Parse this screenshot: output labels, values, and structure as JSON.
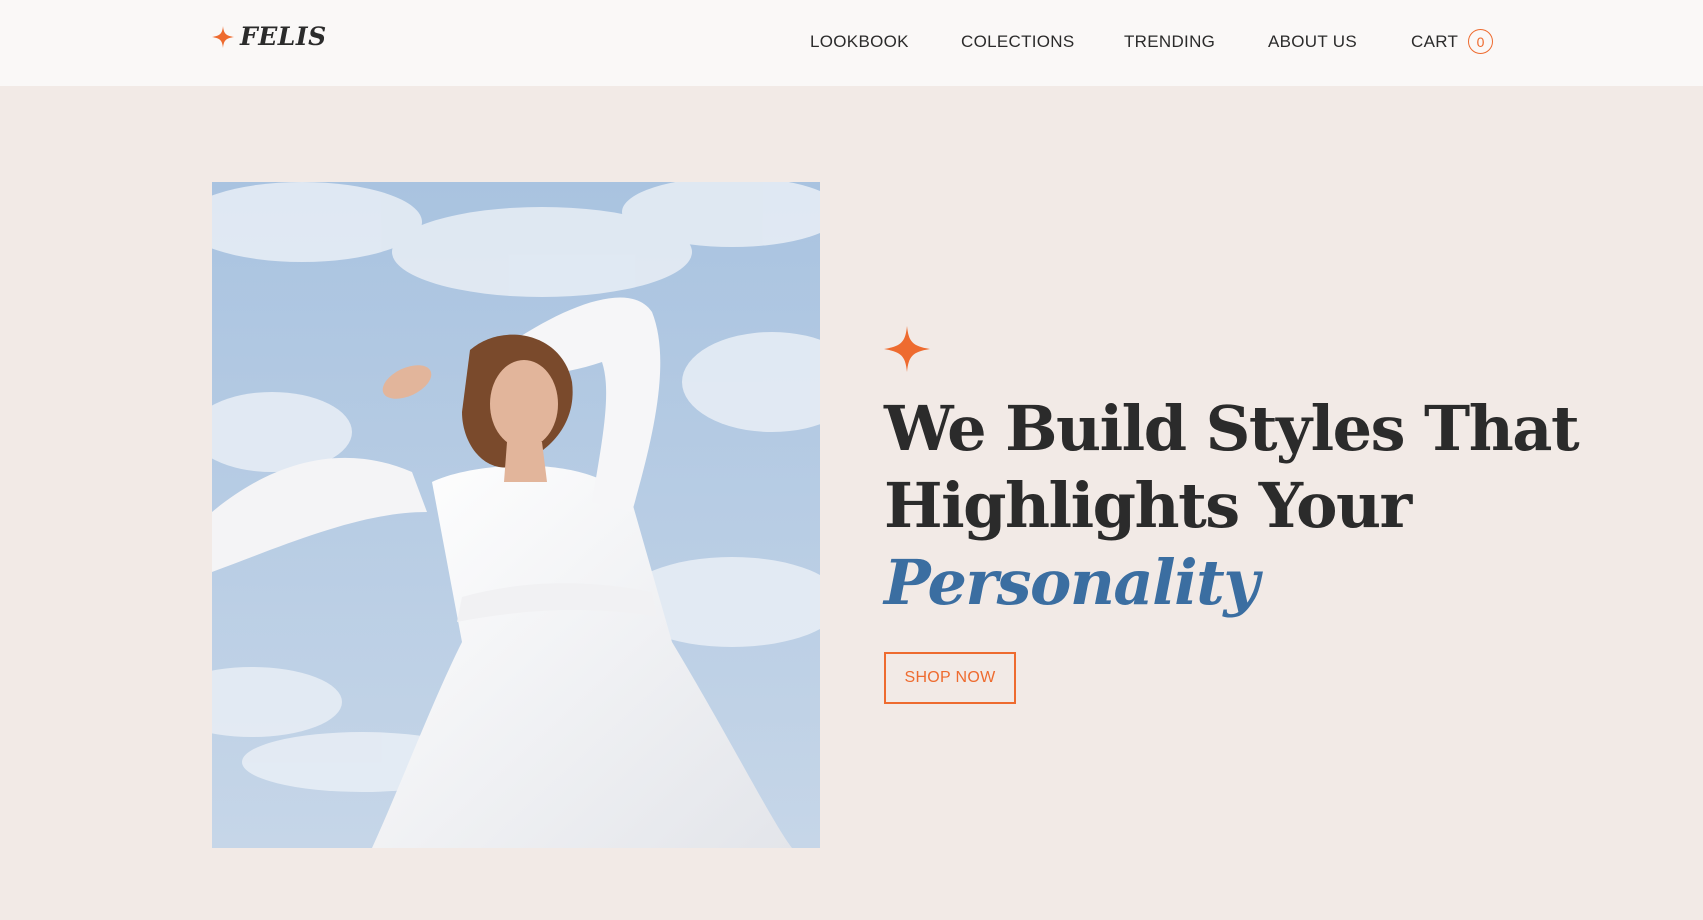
{
  "brand": {
    "name": "FELIS",
    "icon": "sparkle-icon",
    "accent_color": "#ee6b2f"
  },
  "nav": {
    "items": [
      {
        "label": "LOOKBOOK"
      },
      {
        "label": "COLECTIONS"
      },
      {
        "label": "TRENDING"
      },
      {
        "label": "ABOUT US"
      },
      {
        "label": "CART"
      }
    ],
    "cart_count": "0"
  },
  "hero": {
    "image": "woman-in-white-dress-against-sky",
    "headline_line1": "We Build Styles That",
    "headline_line2": "Highlights Your",
    "headline_accent": "Personality",
    "accent_text_color": "#3b6ea1",
    "cta_label": "SHOP NOW"
  },
  "colors": {
    "background": "#f2eae6",
    "header_background": "#faf8f7",
    "text": "#2b2b2b"
  }
}
